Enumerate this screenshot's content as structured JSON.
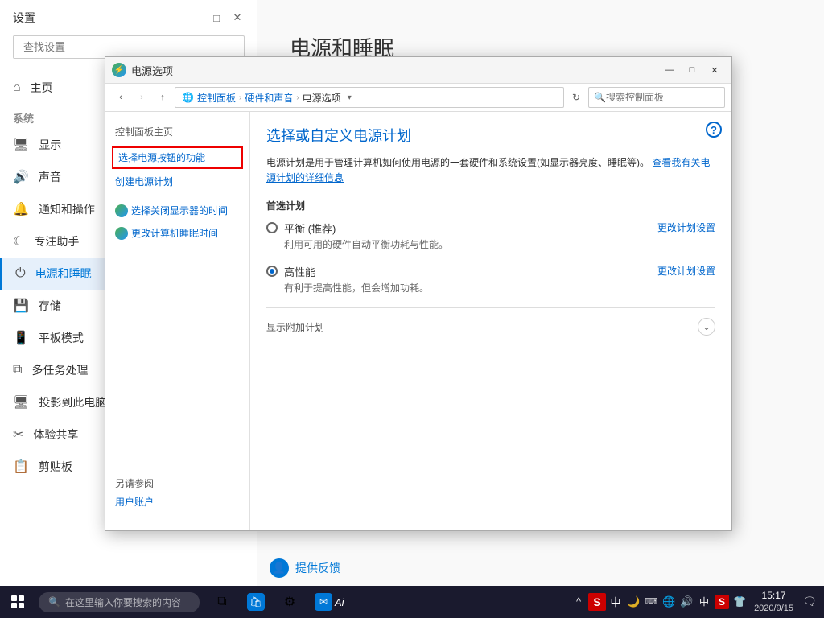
{
  "settings": {
    "title": "设置",
    "search_placeholder": "查找设置",
    "wincontrols": {
      "minimize": "—",
      "maximize": "□",
      "close": "✕"
    },
    "nav_items": [
      {
        "id": "home",
        "icon": "⌂",
        "label": "主页"
      },
      {
        "id": "system",
        "label": "系统",
        "is_header": true
      },
      {
        "id": "display",
        "icon": "□",
        "label": "显示"
      },
      {
        "id": "sound",
        "icon": "♪",
        "label": "声音"
      },
      {
        "id": "notifications",
        "icon": "🔔",
        "label": "通知和操作"
      },
      {
        "id": "focus",
        "icon": "☾",
        "label": "专注助手"
      },
      {
        "id": "power",
        "icon": "⏻",
        "label": "电源和睡眠",
        "active": true
      },
      {
        "id": "storage",
        "icon": "▭",
        "label": "存储"
      },
      {
        "id": "tablet",
        "icon": "⊡",
        "label": "平板模式"
      },
      {
        "id": "multitask",
        "icon": "⧉",
        "label": "多任务处理"
      },
      {
        "id": "project",
        "icon": "⊞",
        "label": "投影到此电脑"
      },
      {
        "id": "share",
        "icon": "✂",
        "label": "体验共享"
      },
      {
        "id": "clipboard",
        "icon": "📋",
        "label": "剪贴板"
      }
    ],
    "page_title": "电源和睡眠"
  },
  "power_dialog": {
    "title": "电源选项",
    "address_bar": {
      "back": "‹",
      "forward": "›",
      "up": "↑",
      "path_icon": "🌐",
      "path": "控制面板 › 硬件和声音 › 电源选项",
      "dropdown": "▾",
      "search_placeholder": "搜索控制面板"
    },
    "sidebar": {
      "title": "控制面板主页",
      "link1": "选择电源按钮的功能",
      "link2": "创建电源计划",
      "link3": "选择关闭显示器的时间",
      "link4": "更改计算机睡眠时间"
    },
    "main": {
      "help_icon": "?",
      "title": "选择或自定义电源计划",
      "description": "电源计划是用于管理计算机如何使用电源的一套硬件和系统设置(如显示器亮度、睡眠等)。",
      "description_link": "查看我有关电源计划的详细信息",
      "section_title": "首选计划",
      "plan1_name": "平衡 (推荐)",
      "plan1_desc": "利用可用的硬件自动平衡功耗与性能。",
      "plan1_link": "更改计划设置",
      "plan2_name": "高性能",
      "plan2_desc": "有利于提高性能，但会增加功耗。",
      "plan2_link": "更改计划设置",
      "plan2_selected": true,
      "additional_label": "显示附加计划",
      "expand_icon": "⌄"
    },
    "footer": {
      "section_title": "另请参阅",
      "link1": "用户账户"
    }
  },
  "feedback": {
    "icon": "👤",
    "label": "提供反馈"
  },
  "taskbar": {
    "search_placeholder": "在这里输入你要搜索的内容",
    "apps": [
      {
        "id": "taskview",
        "icon": "⧉"
      },
      {
        "id": "store",
        "icon": "🏪"
      },
      {
        "id": "settings",
        "icon": "⚙"
      },
      {
        "id": "outlook",
        "icon": "✉"
      }
    ],
    "time": "15:17",
    "date": "2020/9/15",
    "systray_icons": [
      "^",
      "🌐",
      "🔊",
      "中",
      "🌐"
    ],
    "notification": "🗨",
    "ime_label": "Ai",
    "ime_zh": "中"
  }
}
